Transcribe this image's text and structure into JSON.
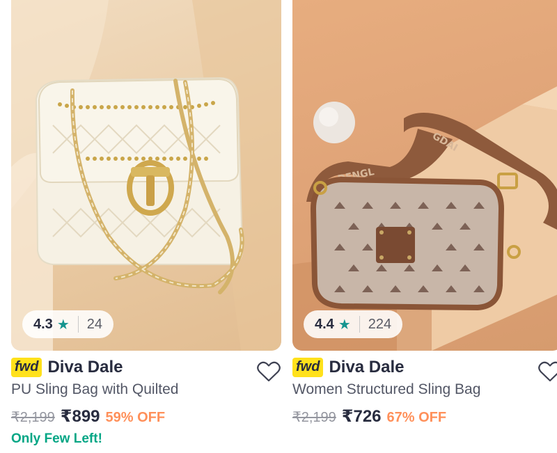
{
  "products": [
    {
      "rating": "4.3",
      "rating_count": "24",
      "badge": "fwd",
      "brand": "Diva Dale",
      "title": "PU Sling Bag with Quilted",
      "mrp": "₹2,199",
      "price": "₹899",
      "discount": "59% OFF",
      "stock_note": "Only Few Left!",
      "image_icon": "white-quilted-chain-sling-bag",
      "colors": {
        "star": "#14958f",
        "discount": "#ff905a",
        "stock": "#03a685",
        "badge": "#ffe11b"
      }
    },
    {
      "rating": "4.4",
      "rating_count": "224",
      "badge": "fwd",
      "brand": "Diva Dale",
      "title": "Women Structured Sling Bag",
      "mrp": "₹2,199",
      "price": "₹726",
      "discount": "67% OFF",
      "image_icon": "brown-monogram-sling-bag",
      "colors": {
        "star": "#14958f",
        "discount": "#ff905a",
        "badge": "#ffe11b"
      }
    }
  ],
  "icons": {
    "star": "star-icon",
    "wishlist": "heart-icon"
  }
}
